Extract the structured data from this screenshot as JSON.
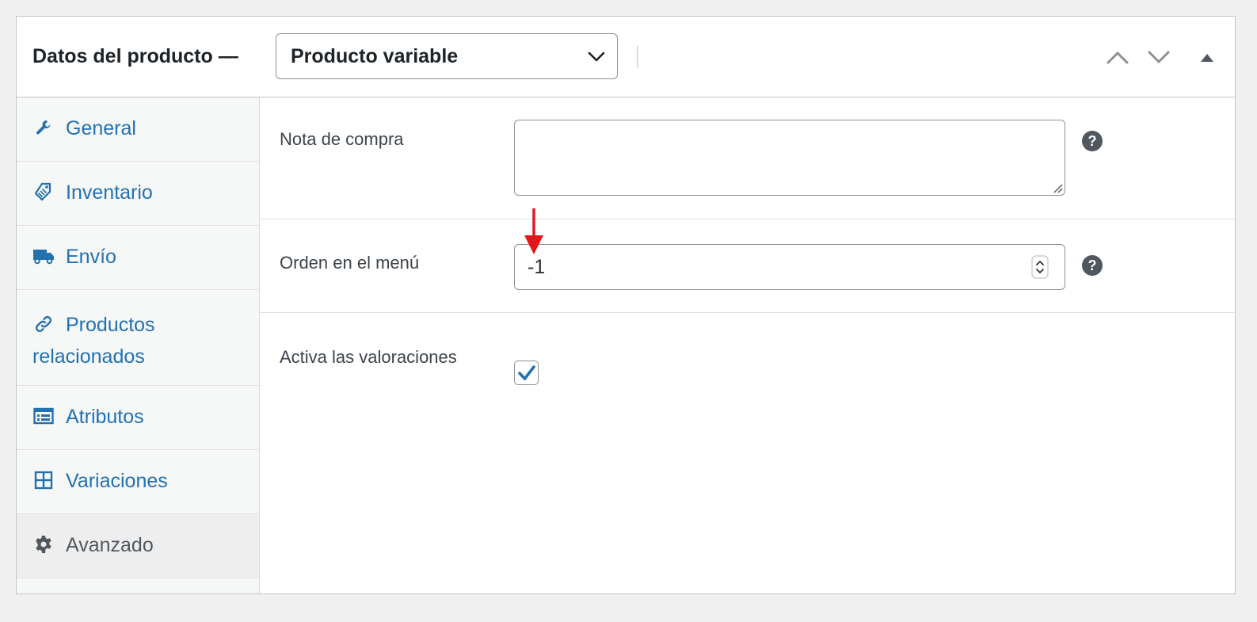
{
  "header": {
    "title": "Datos del producto —",
    "product_type": "Producto variable",
    "buttons": [
      "move-up",
      "move-down",
      "toggle-panel"
    ]
  },
  "sidebar": {
    "items": [
      {
        "label": "General",
        "icon": "wrench-icon"
      },
      {
        "label": "Inventario",
        "icon": "tag-icon"
      },
      {
        "label": "Envío",
        "icon": "truck-icon"
      },
      {
        "label": "Productos relacionados",
        "icon": "link-icon"
      },
      {
        "label": "Atributos",
        "icon": "list-card-icon"
      },
      {
        "label": "Variaciones",
        "icon": "grid-icon"
      },
      {
        "label": "Avanzado",
        "icon": "gear-icon",
        "active": true
      }
    ]
  },
  "fields": {
    "purchase_note": {
      "label": "Nota de compra",
      "value": ""
    },
    "menu_order": {
      "label": "Orden en el menú",
      "value": "-1"
    },
    "enable_reviews": {
      "label": "Activa las valoraciones",
      "checked": true
    }
  },
  "colors": {
    "link": "#2271b1",
    "annotation_arrow": "#e0161b",
    "help_icon": "#50575e"
  }
}
